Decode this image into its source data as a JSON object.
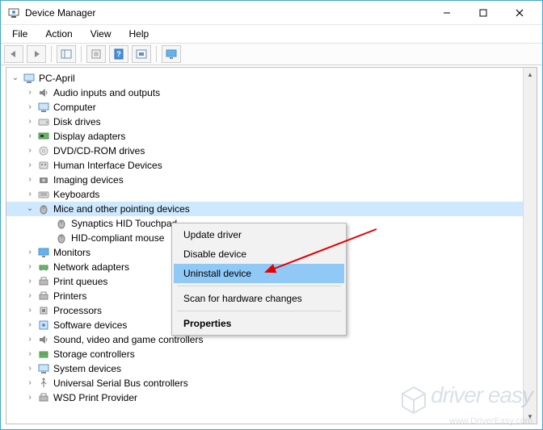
{
  "window": {
    "title": "Device Manager"
  },
  "menubar": {
    "file": "File",
    "action": "Action",
    "view": "View",
    "help": "Help"
  },
  "tree": {
    "root": "PC-April",
    "nodes": {
      "audio": "Audio inputs and outputs",
      "computer": "Computer",
      "disk": "Disk drives",
      "display": "Display adapters",
      "dvd": "DVD/CD-ROM drives",
      "hid": "Human Interface Devices",
      "imaging": "Imaging devices",
      "keyboards": "Keyboards",
      "mice": "Mice and other pointing devices",
      "mice_child1": "Synaptics HID Touchpad",
      "mice_child2": "HID-compliant mouse",
      "monitors": "Monitors",
      "network": "Network adapters",
      "printqueues": "Print queues",
      "printers": "Printers",
      "processors": "Processors",
      "software": "Software devices",
      "sound": "Sound, video and game controllers",
      "storage": "Storage controllers",
      "system": "System devices",
      "usb": "Universal Serial Bus controllers",
      "wsd": "WSD Print Provider"
    }
  },
  "contextMenu": {
    "update": "Update driver",
    "disable": "Disable device",
    "uninstall": "Uninstall device",
    "scan": "Scan for hardware changes",
    "properties": "Properties"
  },
  "watermark": {
    "line1": "driver easy",
    "line2": "www.DriverEasy.com"
  }
}
